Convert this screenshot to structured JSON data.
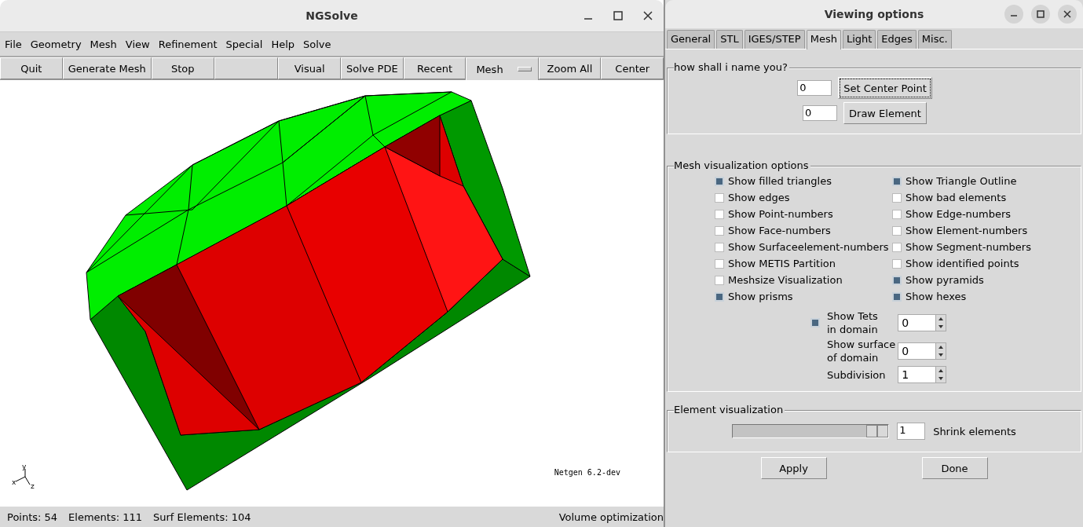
{
  "main_window": {
    "title": "NGSolve",
    "menu": [
      "File",
      "Geometry",
      "Mesh",
      "View",
      "Refinement",
      "Special",
      "Help",
      "Solve"
    ],
    "toolbar": {
      "left": [
        {
          "label": "Quit",
          "kind": "button"
        },
        {
          "label": "Generate Mesh",
          "kind": "button"
        },
        {
          "label": "Stop",
          "kind": "button"
        }
      ],
      "right": [
        {
          "label": "Visual",
          "kind": "button"
        },
        {
          "label": "Solve PDE",
          "kind": "button"
        },
        {
          "label": "Recent",
          "kind": "button"
        },
        {
          "label": "Mesh",
          "kind": "menubutton"
        },
        {
          "label": "Zoom All",
          "kind": "button"
        },
        {
          "label": "Center",
          "kind": "button"
        }
      ]
    },
    "viewport": {
      "axis_labels": {
        "x": "x",
        "y": "y",
        "z": "z"
      },
      "version": "Netgen 6.2-dev"
    },
    "status_bar": [
      "Points: 54",
      "Elements: 111",
      "Surf Elements: 104",
      "Volume optimization"
    ]
  },
  "options_window": {
    "title": "Viewing options",
    "tabs": [
      {
        "label": "General",
        "selected": false
      },
      {
        "label": "STL",
        "selected": false
      },
      {
        "label": "IGES/STEP",
        "selected": false
      },
      {
        "label": "Mesh",
        "selected": true
      },
      {
        "label": "Light",
        "selected": false
      },
      {
        "label": "Edges",
        "selected": false
      },
      {
        "label": "Misc.",
        "selected": false
      }
    ],
    "name_section": {
      "title": "how shall i name you?",
      "rows": [
        {
          "value": "0",
          "button": "Set Center Point",
          "focused": true
        },
        {
          "value": "0",
          "button": "Draw Element",
          "focused": false
        }
      ]
    },
    "mesh_section": {
      "title": "Mesh visualization options",
      "left": [
        {
          "label": "Show filled triangles",
          "checked": true
        },
        {
          "label": "Show edges",
          "checked": false
        },
        {
          "label": "Show Point-numbers",
          "checked": false
        },
        {
          "label": "Show Face-numbers",
          "checked": false
        },
        {
          "label": "Show Surfaceelement-numbers",
          "checked": false
        },
        {
          "label": "Show METIS Partition",
          "checked": false
        },
        {
          "label": "Meshsize Visualization",
          "checked": false
        },
        {
          "label": "Show prisms",
          "checked": true
        }
      ],
      "right": [
        {
          "label": "Show Triangle Outline",
          "checked": true
        },
        {
          "label": "Show bad elements",
          "checked": false
        },
        {
          "label": "Show Edge-numbers",
          "checked": false
        },
        {
          "label": "Show Element-numbers",
          "checked": false
        },
        {
          "label": "Show Segment-numbers",
          "checked": false
        },
        {
          "label": "Show identified points",
          "checked": false
        },
        {
          "label": "Show pyramids",
          "checked": true
        },
        {
          "label": "Show hexes",
          "checked": true
        }
      ],
      "domain": [
        {
          "kind": "check-spin",
          "checked": true,
          "label_lines": [
            "Show Tets",
            "in domain"
          ],
          "value": "0"
        },
        {
          "kind": "spin",
          "label_lines": [
            "Show surface",
            "of domain"
          ],
          "value": "0"
        },
        {
          "kind": "spin",
          "label_lines": [
            "Subdivision"
          ],
          "value": "1"
        }
      ]
    },
    "element_section": {
      "title": "Element visualization",
      "slider": {
        "level": 1
      },
      "value": "1",
      "label": "Shrink elements"
    },
    "buttons": [
      "Apply",
      "Done"
    ]
  }
}
